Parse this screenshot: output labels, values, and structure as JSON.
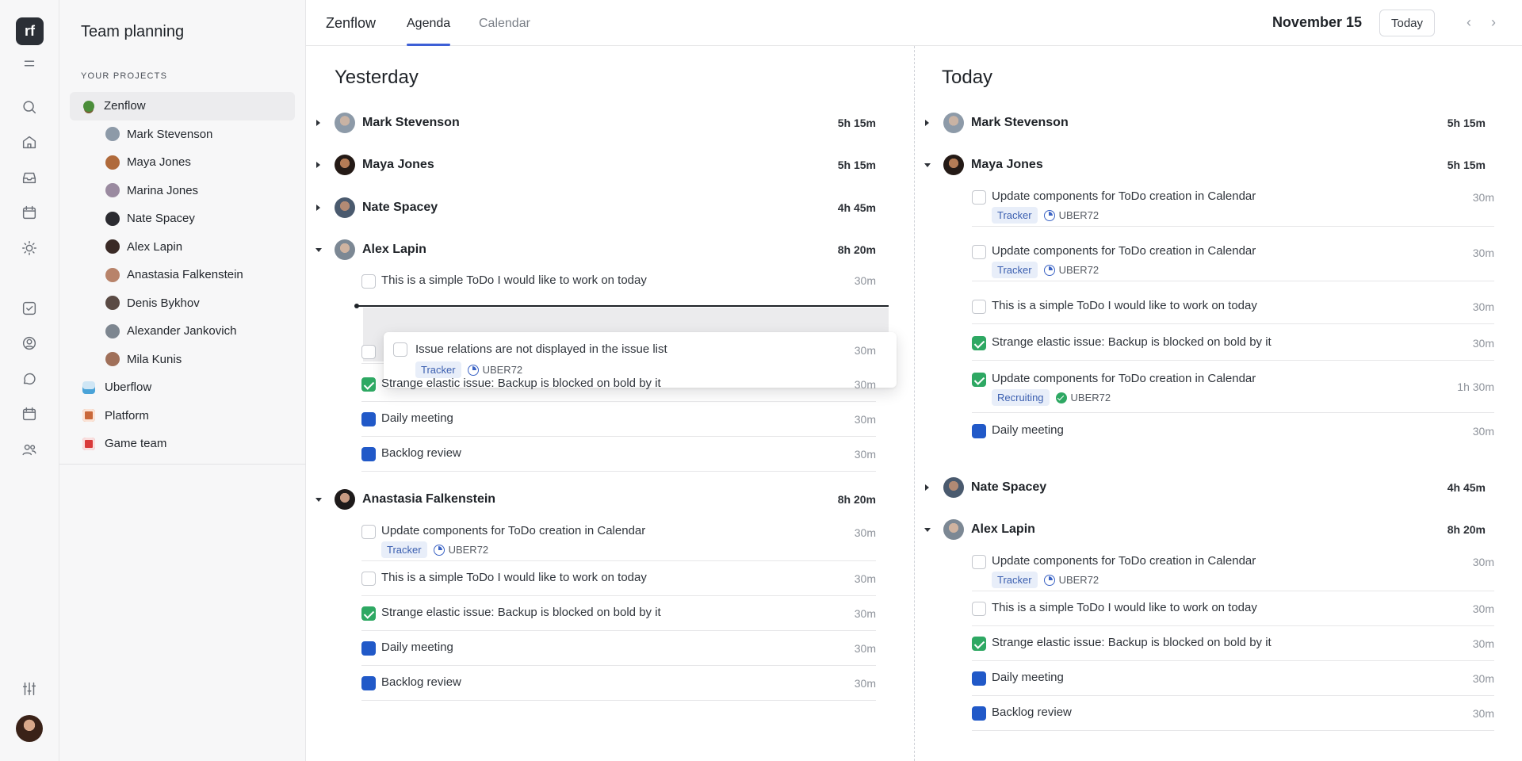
{
  "rail": {
    "logo": "rf",
    "icons": [
      "menu-icon",
      "search-icon",
      "home-icon",
      "inbox-icon",
      "calendar-icon",
      "sun-icon",
      "checkbox-icon",
      "user-circle-icon",
      "chat-icon",
      "calendar-alt-icon",
      "users-icon",
      "sliders-icon"
    ]
  },
  "sidebar": {
    "title": "Team planning",
    "section": "YOUR PROJECTS",
    "projects": [
      {
        "label": "Zenflow",
        "active": true
      },
      {
        "label": "Mark Stevenson",
        "child": true,
        "color": "#8d9aa8"
      },
      {
        "label": "Maya Jones",
        "child": true,
        "color": "#b06a3b"
      },
      {
        "label": "Marina Jones",
        "child": true,
        "color": "#9a8aa0"
      },
      {
        "label": "Nate Spacey",
        "child": true,
        "color": "#2b2b30"
      },
      {
        "label": "Alex Lapin",
        "child": true,
        "color": "#3a2a26"
      },
      {
        "label": "Anastasia Falkenstein",
        "child": true,
        "color": "#b8836a"
      },
      {
        "label": "Denis Bykhov",
        "child": true,
        "color": "#5a4a44"
      },
      {
        "label": "Alexander Jankovich",
        "child": true,
        "color": "#7d8690"
      },
      {
        "label": "Mila Kunis",
        "child": true,
        "color": "#a0705a"
      },
      {
        "label": "Uberflow",
        "color": "#4aa3d8"
      },
      {
        "label": "Platform",
        "color": "#c9683a"
      },
      {
        "label": "Game team",
        "color": "#d93a3a"
      }
    ]
  },
  "topbar": {
    "brand": "Zenflow",
    "tabs": [
      "Agenda",
      "Calendar"
    ],
    "date": "November 15",
    "today": "Today",
    "prev": "‹",
    "next": "›"
  },
  "yesterday": {
    "title": "Yesterday",
    "people": [
      {
        "name": "Mark Stevenson",
        "time": "5h 15m"
      },
      {
        "name": "Maya Jones",
        "time": "5h 15m"
      },
      {
        "name": "Nate Spacey",
        "time": "4h 45m"
      },
      {
        "name": "Alex Lapin",
        "time": "8h 20m"
      },
      {
        "name": "Anastasia Falkenstein",
        "time": "8h 20m"
      }
    ],
    "alex_tasks": [
      {
        "text": "This is a simple ToDo I would like to work on today",
        "dur": "30m"
      },
      {
        "text": "Strange elastic issue: Backup is blocked on bold by it",
        "dur": "30m"
      },
      {
        "text": "Daily meeting",
        "dur": "30m"
      },
      {
        "text": "Backlog review",
        "dur": "30m"
      }
    ],
    "drag": {
      "text": "Issue relations are not displayed in the issue list",
      "dur": "30m",
      "tag": "Tracker",
      "issue": "UBER72"
    },
    "anastasia_tasks": [
      {
        "text": "Update components for ToDo creation in Calendar",
        "dur": "30m",
        "tag": "Tracker",
        "issue": "UBER72"
      },
      {
        "text": "This is a simple ToDo I would like to work on today",
        "dur": "30m"
      },
      {
        "text": "Strange elastic issue: Backup is blocked on bold by it",
        "dur": "30m"
      },
      {
        "text": "Daily meeting",
        "dur": "30m"
      },
      {
        "text": "Backlog review",
        "dur": "30m"
      }
    ]
  },
  "today": {
    "title": "Today",
    "people": [
      {
        "name": "Mark Stevenson",
        "time": "5h 15m"
      },
      {
        "name": "Maya Jones",
        "time": "5h 15m"
      },
      {
        "name": "Nate Spacey",
        "time": "4h 45m"
      },
      {
        "name": "Alex Lapin",
        "time": "8h 20m"
      }
    ],
    "maya_tasks": [
      {
        "text": "Update components for ToDo creation in Calendar",
        "dur": "30m",
        "tag": "Tracker",
        "issue": "UBER72"
      },
      {
        "text": "Update components for ToDo creation in Calendar",
        "dur": "30m",
        "tag": "Tracker",
        "issue": "UBER72"
      },
      {
        "text": "This is a simple ToDo I would like to work on today",
        "dur": "30m"
      },
      {
        "text": "Strange elastic issue: Backup is blocked on bold by it",
        "dur": "30m"
      },
      {
        "text": "Update components for ToDo creation in Calendar",
        "dur": "1h 30m",
        "tag": "Recruiting",
        "issue": "UBER72"
      },
      {
        "text": "Daily meeting",
        "dur": "30m"
      }
    ],
    "alex_tasks": [
      {
        "text": "Update components for ToDo creation in Calendar",
        "dur": "30m",
        "tag": "Tracker",
        "issue": "UBER72"
      },
      {
        "text": "This is a simple ToDo I would like to work on today",
        "dur": "30m"
      },
      {
        "text": "Strange elastic issue: Backup is blocked on bold by it",
        "dur": "30m"
      },
      {
        "text": "Daily meeting",
        "dur": "30m"
      },
      {
        "text": "Backlog review",
        "dur": "30m"
      }
    ]
  }
}
